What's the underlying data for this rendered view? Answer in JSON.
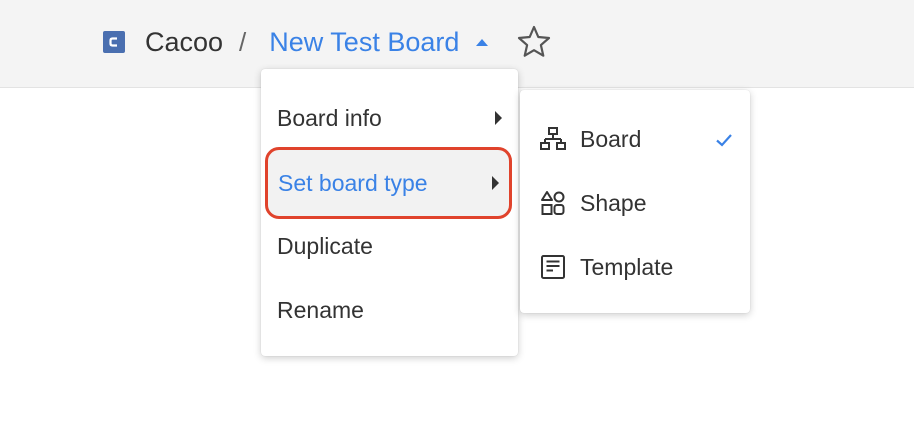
{
  "header": {
    "app_name": "Cacoo",
    "separator": "/",
    "board_title": "New Test Board"
  },
  "board_menu": {
    "items": [
      {
        "label": "Board info",
        "has_submenu": true
      },
      {
        "label": "Set board type",
        "has_submenu": true,
        "highlighted": true
      },
      {
        "label": "Duplicate",
        "has_submenu": false
      },
      {
        "label": "Rename",
        "has_submenu": false
      }
    ]
  },
  "board_type_submenu": {
    "items": [
      {
        "label": "Board",
        "icon": "sitemap-icon",
        "selected": true
      },
      {
        "label": "Shape",
        "icon": "shapes-icon",
        "selected": false
      },
      {
        "label": "Template",
        "icon": "template-icon",
        "selected": false
      }
    ]
  },
  "colors": {
    "accent": "#3a82e6",
    "highlight_border": "#e0432c",
    "header_bg": "#f4f4f4",
    "logo": "#4a6fb0"
  }
}
